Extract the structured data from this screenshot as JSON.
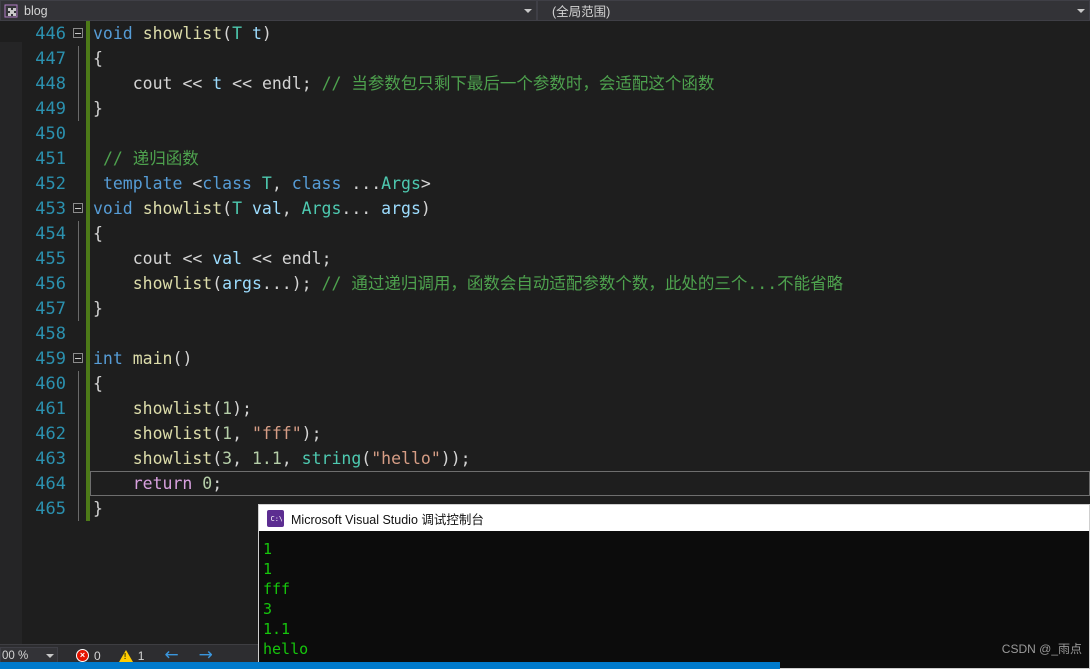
{
  "navbar": {
    "project_combo": {
      "label": "blog",
      "icon": "puzzle-icon",
      "caret": "▾"
    },
    "scope_combo": {
      "label": "(全局范围)",
      "caret": "▾"
    }
  },
  "editor": {
    "language": "cpp",
    "theme": "dark",
    "current_line": 464,
    "lines": [
      {
        "num": "446",
        "fold": "minus",
        "text": "void showlist(T t)"
      },
      {
        "num": "447",
        "fold": "line",
        "text": "{"
      },
      {
        "num": "448",
        "fold": "line",
        "text": "    cout << t << endl; // 当参数包只剩下最后一个参数时，会适配这个函数"
      },
      {
        "num": "449",
        "fold": "line",
        "text": "}"
      },
      {
        "num": "450",
        "fold": "",
        "text": ""
      },
      {
        "num": "451",
        "fold": "",
        "text": " // 递归函数"
      },
      {
        "num": "452",
        "fold": "",
        "text": " template <class T, class ...Args>"
      },
      {
        "num": "453",
        "fold": "minus",
        "text": "void showlist(T val, Args... args)"
      },
      {
        "num": "454",
        "fold": "line",
        "text": "{"
      },
      {
        "num": "455",
        "fold": "line",
        "text": "    cout << val << endl;"
      },
      {
        "num": "456",
        "fold": "line",
        "text": "    showlist(args...); // 通过递归调用，函数会自动适配参数个数，此处的三个...不能省略"
      },
      {
        "num": "457",
        "fold": "line",
        "text": "}"
      },
      {
        "num": "458",
        "fold": "",
        "text": ""
      },
      {
        "num": "459",
        "fold": "minus",
        "text": "int main()"
      },
      {
        "num": "460",
        "fold": "line",
        "text": "{"
      },
      {
        "num": "461",
        "fold": "line",
        "text": "    showlist(1);"
      },
      {
        "num": "462",
        "fold": "line",
        "text": "    showlist(1, \"fff\");"
      },
      {
        "num": "463",
        "fold": "line",
        "text": "    showlist(3, 1.1, string(\"hello\"));"
      },
      {
        "num": "464",
        "fold": "line",
        "text": "    return 0;"
      },
      {
        "num": "465",
        "fold": "line",
        "text": "}"
      }
    ]
  },
  "console": {
    "title": "Microsoft Visual Studio 调试控制台",
    "icon_label": "C:\\",
    "output": [
      "1",
      "1",
      "fff",
      "3",
      "1.1",
      "hello"
    ]
  },
  "statusbar": {
    "zoom_level": "00 %",
    "zoom_caret": "▾",
    "error_count": "0",
    "warning_count": "1",
    "error_icon_glyph": "×",
    "back_arrow": "←",
    "forward_arrow": "→"
  },
  "watermark": {
    "text": "CSDN @_雨点"
  },
  "colors": {
    "editor_bg": "#1e1e1e",
    "chrome_bg": "#2d2d30",
    "line_number": "#2b91af",
    "keyword": "#569cd6",
    "function": "#dcdcaa",
    "type": "#4ec9b0",
    "comment": "#4ea24e",
    "string": "#d69d85",
    "number": "#b5cea8",
    "control": "#d8a0df",
    "variable": "#9cdcfe",
    "console_text": "#16c60c",
    "accent_blue": "#007acc",
    "change_bar": "#4d7a18"
  }
}
